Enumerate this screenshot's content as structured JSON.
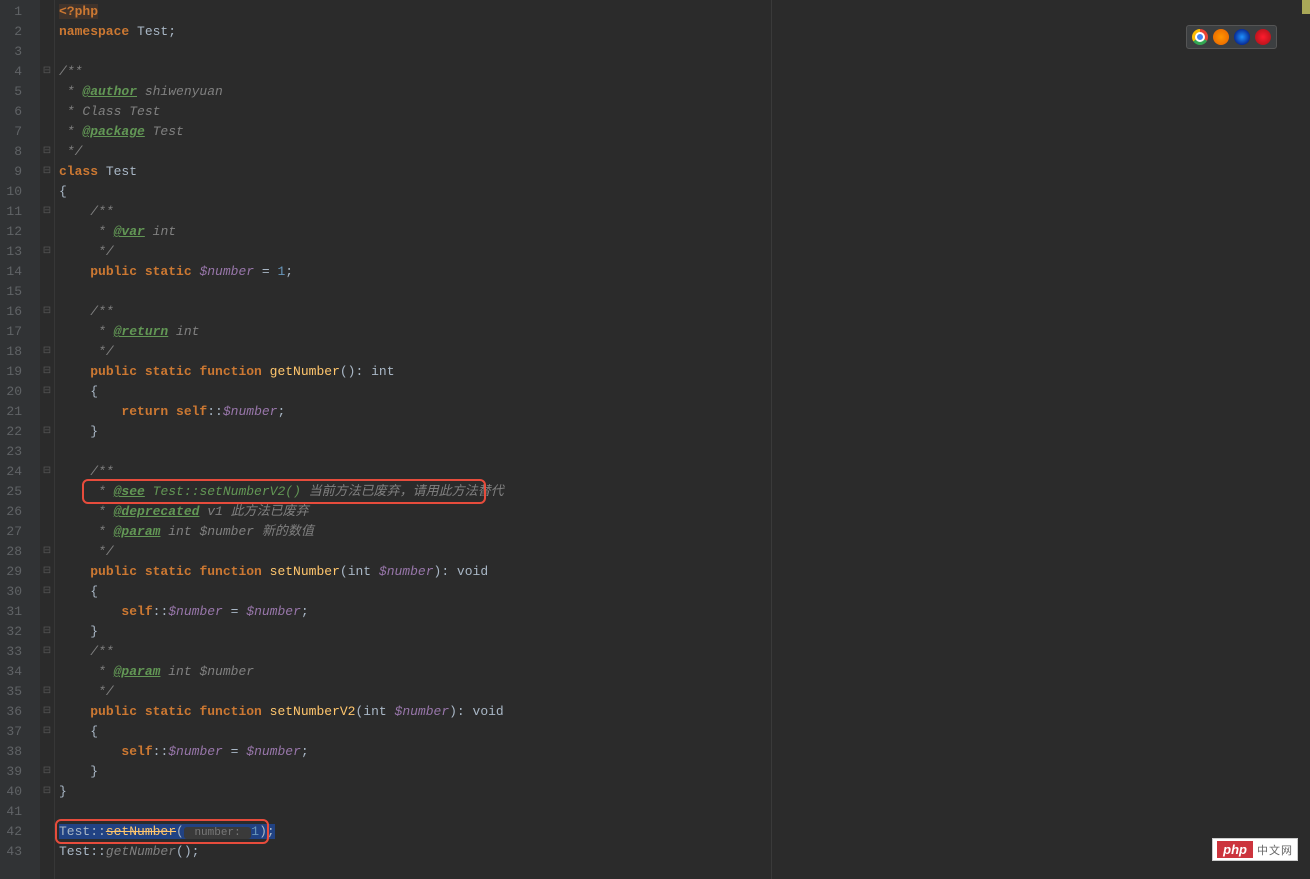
{
  "browsers": [
    "chrome",
    "firefox",
    "safari",
    "opera"
  ],
  "watermark": {
    "logo": "php",
    "text": "中文网"
  },
  "gutter": [
    "1",
    "2",
    "3",
    "4",
    "5",
    "6",
    "7",
    "8",
    "9",
    "10",
    "11",
    "12",
    "13",
    "14",
    "15",
    "16",
    "17",
    "18",
    "19",
    "20",
    "21",
    "22",
    "23",
    "24",
    "25",
    "26",
    "27",
    "28",
    "29",
    "30",
    "31",
    "32",
    "33",
    "34",
    "35",
    "36",
    "37",
    "38",
    "39",
    "40",
    "41",
    "42",
    "43",
    ""
  ],
  "code": {
    "l1": {
      "phptag": "<?php"
    },
    "l2": {
      "kw": "namespace ",
      "name": "Test",
      "semi": ";"
    },
    "l3": {
      "blank": ""
    },
    "l4": {
      "doc": "/**"
    },
    "l5": {
      "star": " * ",
      "ann": "@author",
      "rest": " shiwenyuan"
    },
    "l6": {
      "star": " * ",
      "rest": "Class Test"
    },
    "l7": {
      "star": " * ",
      "ann": "@package",
      "rest": " Test"
    },
    "l8": {
      "doc": " */"
    },
    "l9": {
      "kw": "class ",
      "name": "Test"
    },
    "l10": {
      "brace": "{"
    },
    "l11": {
      "indent": "    ",
      "doc": "/**"
    },
    "l12": {
      "indent": "    ",
      "star": " * ",
      "ann": "@var",
      "rest": " int"
    },
    "l13": {
      "indent": "    ",
      "doc": " */"
    },
    "l14": {
      "indent": "    ",
      "kw1": "public ",
      "kw2": "static ",
      "var": "$number",
      "op": " = ",
      "num": "1",
      "semi": ";"
    },
    "l15": {
      "blank": ""
    },
    "l16": {
      "indent": "    ",
      "doc": "/**"
    },
    "l17": {
      "indent": "    ",
      "star": " * ",
      "ann": "@return",
      "rest": " int"
    },
    "l18": {
      "indent": "    ",
      "doc": " */"
    },
    "l19": {
      "indent": "    ",
      "kw1": "public ",
      "kw2": "static ",
      "kw3": "function ",
      "fn": "getNumber",
      "sig": "(): ",
      "ret": "int"
    },
    "l20": {
      "indent": "    ",
      "brace": "{"
    },
    "l21": {
      "indent": "        ",
      "kw": "return ",
      "self": "self",
      "op": "::",
      "var": "$number",
      "semi": ";"
    },
    "l22": {
      "indent": "    ",
      "brace": "}"
    },
    "l23": {
      "blank": ""
    },
    "l24": {
      "indent": "    ",
      "doc": "/**"
    },
    "l25": {
      "indent": "    ",
      "star": " * ",
      "ann": "@see",
      "link": " Test::setNumberV2()",
      "rest": " 当前方法已废弃，请用此方法替代"
    },
    "l26": {
      "indent": "    ",
      "star": " * ",
      "ann": "@deprecated",
      "rest": " v1 此方法已废弃"
    },
    "l27": {
      "indent": "    ",
      "star": " * ",
      "ann": "@param",
      "rest": " int $number 新的数值"
    },
    "l28": {
      "indent": "    ",
      "doc": " */"
    },
    "l29": {
      "indent": "    ",
      "kw1": "public ",
      "kw2": "static ",
      "kw3": "function ",
      "fn": "setNumber",
      "paropen": "(",
      "t": "int ",
      "var": "$number",
      "parclose": "): ",
      "ret": "void"
    },
    "l30": {
      "indent": "    ",
      "brace": "{"
    },
    "l31": {
      "indent": "        ",
      "self": "self",
      "op": "::",
      "var": "$number",
      "eq": " = ",
      "var2": "$number",
      "semi": ";"
    },
    "l32": {
      "indent": "    ",
      "brace": "}"
    },
    "l33": {
      "indent": "    ",
      "doc": "/**"
    },
    "l34": {
      "indent": "    ",
      "star": " * ",
      "ann": "@param",
      "rest": " int $number"
    },
    "l35": {
      "indent": "    ",
      "doc": " */"
    },
    "l36": {
      "indent": "    ",
      "kw1": "public ",
      "kw2": "static ",
      "kw3": "function ",
      "fn": "setNumberV2",
      "paropen": "(",
      "t": "int ",
      "var": "$number",
      "parclose": "): ",
      "ret": "void"
    },
    "l37": {
      "indent": "    ",
      "brace": "{"
    },
    "l38": {
      "indent": "        ",
      "self": "self",
      "op": "::",
      "var": "$number",
      "eq": " = ",
      "var2": "$number",
      "semi": ";"
    },
    "l39": {
      "indent": "    ",
      "brace": "}"
    },
    "l40": {
      "brace": "}"
    },
    "l41": {
      "blank": ""
    },
    "l42": {
      "cls": "Test",
      "op": "::",
      "fn": "setNumber",
      "paropen": "(",
      "hint": " number: ",
      "num": "1",
      "parclose": ")",
      "semi": ";"
    },
    "l43": {
      "cls": "Test",
      "op": "::",
      "fn": "getNumber",
      "paropen": "()",
      "semi": ";"
    }
  }
}
